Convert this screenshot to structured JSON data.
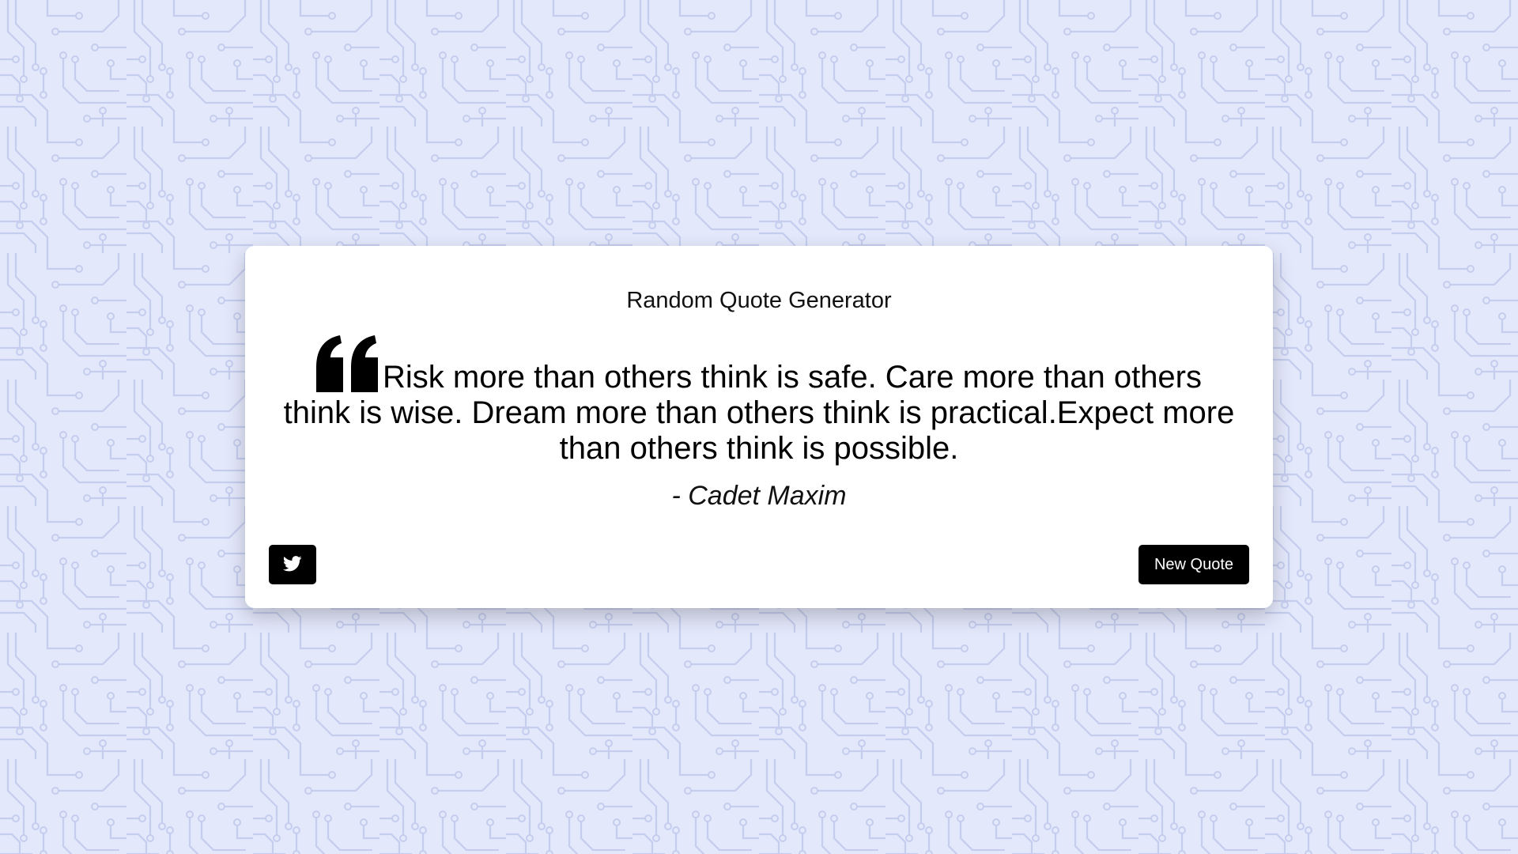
{
  "app": {
    "title": "Random Quote Generator"
  },
  "quote": {
    "text": "Risk more than others think is safe. Care more than others think is wise. Dream more than others think is practical.Expect more than others think is possible.",
    "author": "- Cadet Maxim",
    "icon": "quote-left-icon"
  },
  "actions": {
    "tweet_icon": "twitter-icon",
    "new_quote_label": "New Quote"
  },
  "colors": {
    "background": "#e3e8fb",
    "pattern_line": "#c4cdf0",
    "card": "#ffffff",
    "button": "#000000",
    "button_text": "#ffffff"
  }
}
